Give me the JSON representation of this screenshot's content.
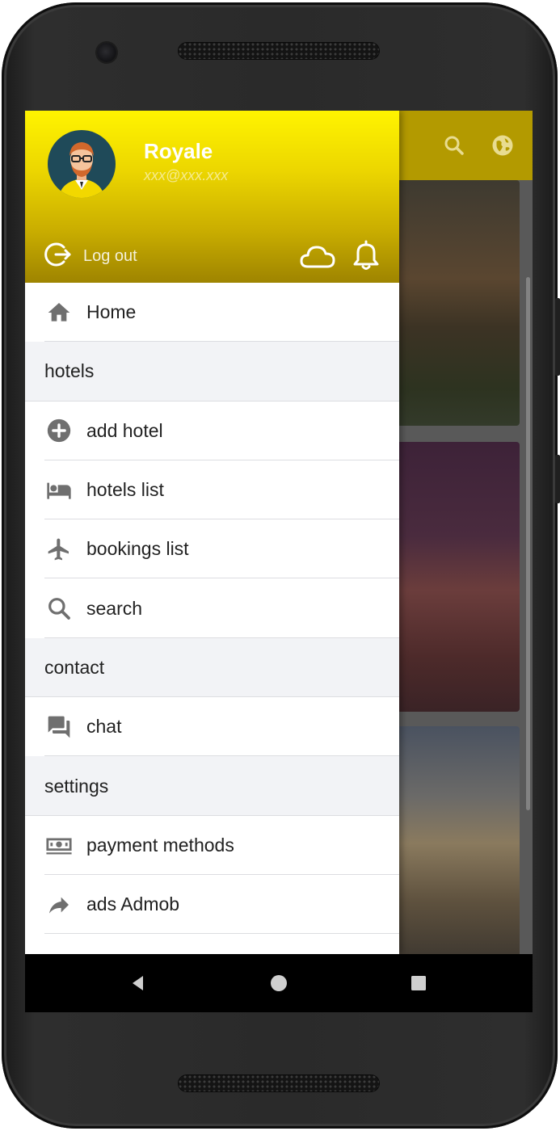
{
  "user": {
    "name": "Royale",
    "email": "xxx@xxx.xxx"
  },
  "header": {
    "logout_label": "Log out",
    "icons": [
      "logout-icon",
      "cloud-icon",
      "bell-icon"
    ]
  },
  "app_bar": {
    "icons": [
      "search-icon",
      "globe-icon"
    ],
    "color": "#b39a00"
  },
  "menu": {
    "items": [
      {
        "type": "item",
        "label": "Home",
        "icon": "home-icon"
      },
      {
        "type": "section",
        "label": "hotels"
      },
      {
        "type": "item",
        "label": "add hotel",
        "icon": "add-circle-icon"
      },
      {
        "type": "item",
        "label": "hotels list",
        "icon": "bed-icon"
      },
      {
        "type": "item",
        "label": "bookings list",
        "icon": "airplane-icon"
      },
      {
        "type": "item",
        "label": "search",
        "icon": "search-icon"
      },
      {
        "type": "section",
        "label": "contact"
      },
      {
        "type": "item",
        "label": "chat",
        "icon": "chat-icon"
      },
      {
        "type": "section",
        "label": "settings"
      },
      {
        "type": "item",
        "label": "payment methods",
        "icon": "money-icon"
      },
      {
        "type": "item",
        "label": "ads Admob",
        "icon": "share-arrow-icon"
      }
    ]
  },
  "nav": {
    "buttons": [
      "back-icon",
      "home-circle-icon",
      "recents-square-icon"
    ]
  },
  "colors": {
    "header_top": "#fff400",
    "header_bottom": "#9e8400",
    "section_bg": "#f2f3f6",
    "icon_gray": "#6f6f6f"
  }
}
